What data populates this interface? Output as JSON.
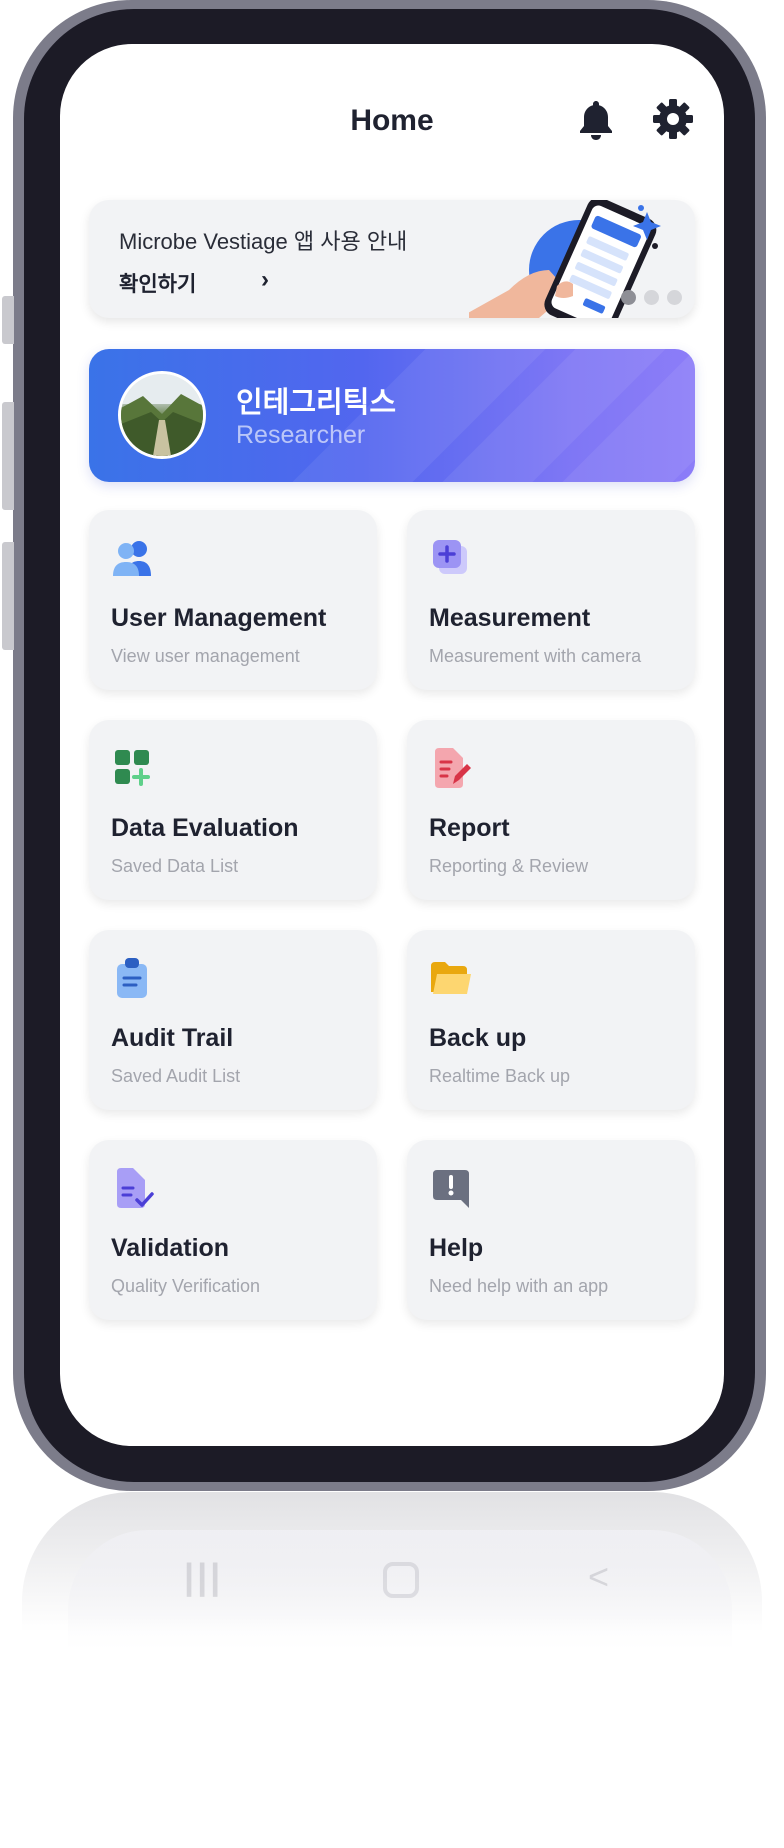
{
  "header": {
    "title": "Home",
    "bell_icon": "bell-icon",
    "settings_icon": "gear-icon"
  },
  "banner": {
    "title": "Microbe Vestiage 앱 사용 안내",
    "link_label": "확인하기",
    "link_icon": "chevron-right-icon",
    "pagination": {
      "total": 3,
      "active": 1
    }
  },
  "profile": {
    "name": "인테그리틱스",
    "role": "Researcher"
  },
  "menu": [
    {
      "title": "User Management",
      "subtitle": "View user management",
      "icon": "users-icon"
    },
    {
      "title": "Measurement",
      "subtitle": "Measurement with camera",
      "icon": "add-layer-icon"
    },
    {
      "title": "Data Evaluation",
      "subtitle": "Saved Data List",
      "icon": "grid-add-icon"
    },
    {
      "title": "Report",
      "subtitle": "Reporting & Review",
      "icon": "document-edit-icon"
    },
    {
      "title": "Audit Trail",
      "subtitle": "Saved Audit List",
      "icon": "clipboard-icon"
    },
    {
      "title": "Back up",
      "subtitle": "Realtime Back up",
      "icon": "folder-icon"
    },
    {
      "title": "Validation",
      "subtitle": "Quality Verification",
      "icon": "document-check-icon"
    },
    {
      "title": "Help",
      "subtitle": "Need help with an app",
      "icon": "message-alert-icon"
    }
  ],
  "colors": {
    "accent_blue": "#3a73e8",
    "accent_purple": "#8c7df8",
    "card_bg": "#f2f3f5",
    "text_primary": "#1f2230",
    "text_muted": "#a3a5ad"
  }
}
